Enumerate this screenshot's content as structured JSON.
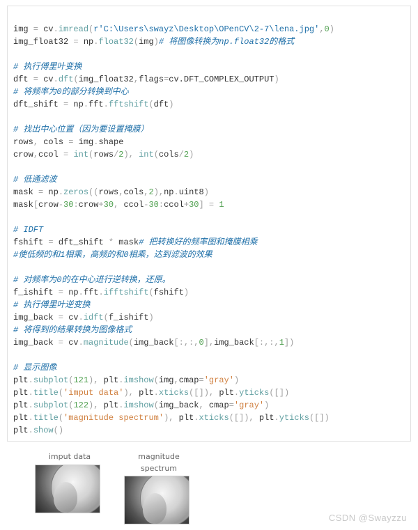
{
  "code": {
    "l1_img": "img",
    "l1_eq": " = ",
    "l1_cv": "cv",
    "l1_dot1": ".",
    "l1_imread": "imread",
    "l1_open": "(",
    "l1_r": "r",
    "l1_path": "'C:\\Users\\swayz\\Desktop\\OPenCV\\2-7\\lena.jpg'",
    "l1_comma": ",",
    "l1_zero": "0",
    "l1_close": ")",
    "l2_imgf": "img_float32",
    "l2_eq": " = ",
    "l2_np": "np",
    "l2_dot": ".",
    "l2_f32": "float32",
    "l2_open": "(",
    "l2_arg": "img",
    "l2_close": ")",
    "l2_cmt": "# 将图像转换为np.float32的格式",
    "l3_cmt": "# 执行傅里叶变换",
    "l4_dft": "dft",
    "l4_eq": " = ",
    "l4_cv": "cv",
    "l4_dot": ".",
    "l4_fn": "dft",
    "l4_args_open": "(",
    "l4_a1": "img_float32",
    "l4_c1": ",",
    "l4_flags": "flags",
    "l4_eq2": "=",
    "l4_enum": "cv.DFT_COMPLEX_OUTPUT",
    "l4_close": ")",
    "l5_cmt": "# 将频率为0的部分转换到中心",
    "l6_ds": "dft_shift",
    "l6_eq": " = ",
    "l6_np": "np",
    "l6_d1": ".",
    "l6_fft": "fft",
    "l6_d2": ".",
    "l6_fn": "fftshift",
    "l6_open": "(",
    "l6_arg": "dft",
    "l6_close": ")",
    "l7_cmt": "# 找出中心位置（因为要设置掩膜）",
    "l8_rows": "rows",
    "l8_c1": ", ",
    "l8_cols": "cols",
    "l8_eq": " = ",
    "l8_img": "img",
    "l8_dot": ".",
    "l8_shape": "shape",
    "l9_crow": "crow",
    "l9_c1": ",",
    "l9_ccol": "ccol",
    "l9_eq": " = ",
    "l9_int1": "int",
    "l9_open1": "(",
    "l9_rows": "rows",
    "l9_div1": "/",
    "l9_two1": "2",
    "l9_close1": ")",
    "l9_c2": ", ",
    "l9_int2": "int",
    "l9_open2": "(",
    "l9_cols": "cols",
    "l9_div2": "/",
    "l9_two2": "2",
    "l9_close2": ")",
    "l10_cmt": "# 低通滤波",
    "l11_mask": "mask",
    "l11_eq": " = ",
    "l11_np": "np",
    "l11_dot": ".",
    "l11_fn": "zeros",
    "l11_open": "((",
    "l11_rows": "rows",
    "l11_c1": ",",
    "l11_cols": "cols",
    "l11_c2": ",",
    "l11_two": "2",
    "l11_close1": ")",
    "l11_c3": ",",
    "l11_np2": "np",
    "l11_dot2": ".",
    "l11_u8": "uint8",
    "l11_close2": ")",
    "l12_mask": "mask",
    "l12_open": "[",
    "l12_crow": "crow",
    "l12_m1": "-",
    "l12_30a": "30",
    "l12_colon1": ":",
    "l12_crow2": "crow",
    "l12_p1": "+",
    "l12_30b": "30",
    "l12_c1": ", ",
    "l12_ccol": "ccol",
    "l12_m2": "-",
    "l12_30c": "30",
    "l12_colon2": ":",
    "l12_ccol2": "ccol",
    "l12_p2": "+",
    "l12_30d": "30",
    "l12_close": "]",
    "l12_eq": " = ",
    "l12_one": "1",
    "l13_cmt": "# IDFT",
    "l14_fs": "fshift",
    "l14_eq": " = ",
    "l14_ds": "dft_shift",
    "l14_sp": " ",
    "l14_star": "*",
    "l14_sp2": " ",
    "l14_mask": "mask",
    "l14_cmt": "# 把转换好的频率图和掩膜相乘",
    "l15_cmt": "#使低频的和1相乘，高频的和0相乘，达到滤波的效果",
    "l16_cmt": "# 对频率为0的在中心进行逆转换，还原。",
    "l17_fi": "f_ishift",
    "l17_eq": " = ",
    "l17_np": "np",
    "l17_d1": ".",
    "l17_fft": "fft",
    "l17_d2": ".",
    "l17_fn": "ifftshift",
    "l17_open": "(",
    "l17_arg": "fshift",
    "l17_close": ")",
    "l18_cmt": "# 执行傅里叶逆变换",
    "l19_ib": "img_back",
    "l19_eq": " = ",
    "l19_cv": "cv",
    "l19_dot": ".",
    "l19_fn": "idft",
    "l19_open": "(",
    "l19_arg": "f_ishift",
    "l19_close": ")",
    "l20_cmt": "# 将得到的结果转换为图像格式",
    "l21_ib": "img_back",
    "l21_eq": " = ",
    "l21_cv": "cv",
    "l21_dot": ".",
    "l21_fn": "magnitude",
    "l21_open": "(",
    "l21_a1": "img_back",
    "l21_idx1": "[:,:,",
    "l21_zero": "0",
    "l21_idx1c": "]",
    "l21_c1": ",",
    "l21_a2": "img_back",
    "l21_idx2": "[:,:,",
    "l21_one": "1",
    "l21_idx2c": "]",
    "l21_close": ")",
    "l22_cmt": "# 显示图像",
    "l23_plt": "plt",
    "l23_dot": ".",
    "l23_fn": "subplot",
    "l23_open": "(",
    "l23_num": "121",
    "l23_close": ")",
    "l23_c1": ", ",
    "l23_plt2": "plt",
    "l23_dot2": ".",
    "l23_fn2": "imshow",
    "l23_open2": "(",
    "l23_arg": "img",
    "l23_c2": ",",
    "l23_cmap": "cmap",
    "l23_eq": "=",
    "l23_gray": "'gray'",
    "l23_close2": ")",
    "l24_plt": "plt",
    "l24_dot": ".",
    "l24_fn": "title",
    "l24_open": "(",
    "l24_str": "'imput data'",
    "l24_close": ")",
    "l24_c1": ", ",
    "l24_plt2": "plt",
    "l24_dot2": ".",
    "l24_fn2": "xticks",
    "l24_args2": "([])",
    "l24_c2": ", ",
    "l24_plt3": "plt",
    "l24_dot3": ".",
    "l24_fn3": "yticks",
    "l24_args3": "([])",
    "l25_plt": "plt",
    "l25_dot": ".",
    "l25_fn": "subplot",
    "l25_open": "(",
    "l25_num": "122",
    "l25_close": ")",
    "l25_c1": ", ",
    "l25_plt2": "plt",
    "l25_dot2": ".",
    "l25_fn2": "imshow",
    "l25_open2": "(",
    "l25_arg": "img_back",
    "l25_c2": ", ",
    "l25_cmap": "cmap",
    "l25_eq": "=",
    "l25_gray": "'gray'",
    "l25_close2": ")",
    "l26_plt": "plt",
    "l26_dot": ".",
    "l26_fn": "title",
    "l26_open": "(",
    "l26_str": "'magnitude spectrum'",
    "l26_close": ")",
    "l26_c1": ", ",
    "l26_plt2": "plt",
    "l26_dot2": ".",
    "l26_fn2": "xticks",
    "l26_args2": "([])",
    "l26_c2": ", ",
    "l26_plt3": "plt",
    "l26_dot3": ".",
    "l26_fn3": "yticks",
    "l26_args3": "([])",
    "l27_plt": "plt",
    "l27_dot": ".",
    "l27_fn": "show",
    "l27_args": "()"
  },
  "plots": {
    "left_title": "imput data",
    "right_title": "magnitude spectrum"
  },
  "watermark": "CSDN @Swayzzu"
}
